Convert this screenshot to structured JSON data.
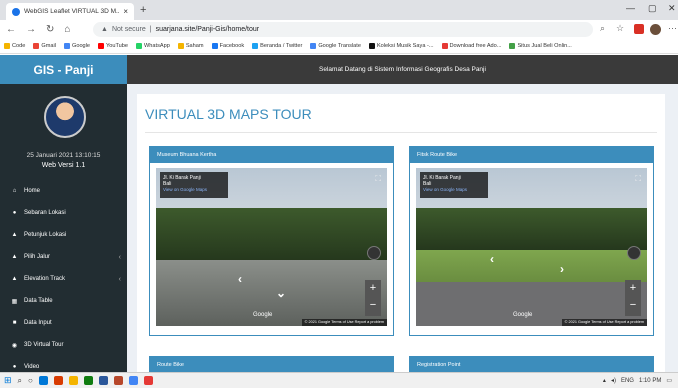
{
  "browser": {
    "tab_title": "WebGIS Leaflet VIRTUAL 3D M...",
    "close_glyph": "×",
    "newtab_glyph": "+",
    "security": "Not secure",
    "url": "suarjana.site/Panji-Gis/home/tour",
    "bookmarks": [
      {
        "label": "Code",
        "color": "#f4b400"
      },
      {
        "label": "Gmail",
        "color": "#ea4335"
      },
      {
        "label": "Google",
        "color": "#4285f4"
      },
      {
        "label": "YouTube",
        "color": "#ff0000"
      },
      {
        "label": "WhatsApp",
        "color": "#25d366"
      },
      {
        "label": "Saham",
        "color": "#f4b400"
      },
      {
        "label": "Facebook",
        "color": "#1877f2"
      },
      {
        "label": "Beranda / Twitter",
        "color": "#1da1f2"
      },
      {
        "label": "Google Translate",
        "color": "#4285f4"
      },
      {
        "label": "Koleksi Musik Saya -...",
        "color": "#111111"
      },
      {
        "label": "Download free Ado...",
        "color": "#e53935"
      },
      {
        "label": "Situs Jual Beli Onlin...",
        "color": "#43a047"
      }
    ]
  },
  "app": {
    "brand": "GIS - Panji",
    "welcome": "Selamat Datang di Sistem Informasi Geografis Desa Panji",
    "datetime": "25 Januari 2021 13:10:15",
    "version": "Web Versi 1.1"
  },
  "sidebar": {
    "items": [
      {
        "label": "Home",
        "icon": "home-icon",
        "glyph": "⌂",
        "chevron": false
      },
      {
        "label": "Sebaran Lokasi",
        "icon": "location-icon",
        "glyph": "●",
        "chevron": false
      },
      {
        "label": "Petunjuk Lokasi",
        "icon": "direction-icon",
        "glyph": "▲",
        "chevron": false
      },
      {
        "label": "Pilih Jalur",
        "icon": "route-icon",
        "glyph": "▲",
        "chevron": true
      },
      {
        "label": "Elevation Track",
        "icon": "elevation-icon",
        "glyph": "▲",
        "chevron": true
      },
      {
        "label": "Data Table",
        "icon": "table-icon",
        "glyph": "▦",
        "chevron": false
      },
      {
        "label": "Data Input",
        "icon": "input-icon",
        "glyph": "■",
        "chevron": false
      },
      {
        "label": "3D Virtual Tour",
        "icon": "eye-icon",
        "glyph": "◉",
        "chevron": false
      },
      {
        "label": "Video",
        "icon": "video-icon",
        "glyph": "●",
        "chevron": false
      }
    ]
  },
  "main": {
    "title": "VIRTUAL 3D MAPS TOUR",
    "cards": [
      {
        "header": "Museum Bhuana Kertha",
        "place": "Jl. Ki Barak Panji",
        "region": "Bali",
        "link": "View on Google Maps",
        "footer": "© 2021 Google  Terms of Use  Report a problem",
        "brand": "Google"
      },
      {
        "header": "Fitsk Route Bike",
        "place": "Jl. Ki Barak Panji",
        "region": "Bali",
        "link": "View on Google Maps",
        "footer": "© 2021 Google  Terms of Use  Report a problem",
        "brand": "Google"
      },
      {
        "header": "Route Bike"
      },
      {
        "header": "Registration Point"
      }
    ]
  },
  "taskbar": {
    "lang": "ENG",
    "time": "1:10 PM"
  }
}
